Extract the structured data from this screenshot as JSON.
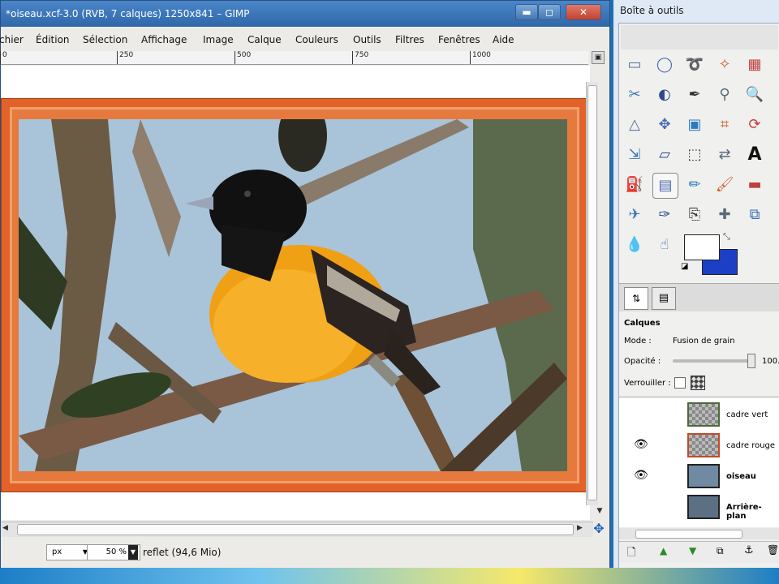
{
  "window": {
    "title": "*oiseau.xcf-3.0 (RVB, 7 calques) 1250x841 – GIMP",
    "controls": {
      "minimize": "▬",
      "maximize": "◻",
      "close": "✕"
    }
  },
  "menu": [
    "chier",
    "Édition",
    "Sélection",
    "Affichage",
    "Image",
    "Calque",
    "Couleurs",
    "Outils",
    "Filtres",
    "Fenêtres",
    "Aide"
  ],
  "ruler": {
    "ticks": [
      "0",
      "250",
      "500",
      "750",
      "1000"
    ]
  },
  "statusbar": {
    "unit": "px",
    "zoom": "50 %",
    "info": "reflet (94,6 Mio)"
  },
  "toolbox": {
    "title": "Boîte à outils",
    "tools": [
      "rect-select-icon",
      "ellipse-select-icon",
      "lasso-icon",
      "fuzzy-select-icon",
      "color-select-icon",
      "scissors-icon",
      "foreground-select-icon",
      "paths-icon",
      "color-picker-icon",
      "zoom-icon",
      "measure-icon",
      "move-icon",
      "align-icon",
      "crop-icon",
      "rotate-icon",
      "scale-icon",
      "shear-icon",
      "perspective-icon",
      "flip-icon",
      "text-icon",
      "bucket-fill-icon",
      "blend-icon",
      "pencil-icon",
      "paintbrush-icon",
      "eraser-icon",
      "airbrush-icon",
      "ink-icon",
      "clone-icon",
      "heal-icon",
      "perspective-clone-icon",
      "blur-icon",
      "smudge-icon",
      "dodge-burn-icon"
    ],
    "colors": {
      "foreground": "#ffffff",
      "background": "#1c3fc6"
    }
  },
  "layers": {
    "heading": "Calques",
    "mode_label": "Mode :",
    "mode_value": "Fusion de grain",
    "opacity_label": "Opacité :",
    "opacity_value": "100.",
    "lock_label": "Verrouiller :",
    "items": [
      {
        "name": "cadre vert",
        "visible": false,
        "bold": false
      },
      {
        "name": "cadre rouge",
        "visible": true,
        "bold": false
      },
      {
        "name": "oiseau",
        "visible": true,
        "bold": true
      },
      {
        "name": "Arrière-plan",
        "visible": false,
        "bold": true
      }
    ]
  }
}
